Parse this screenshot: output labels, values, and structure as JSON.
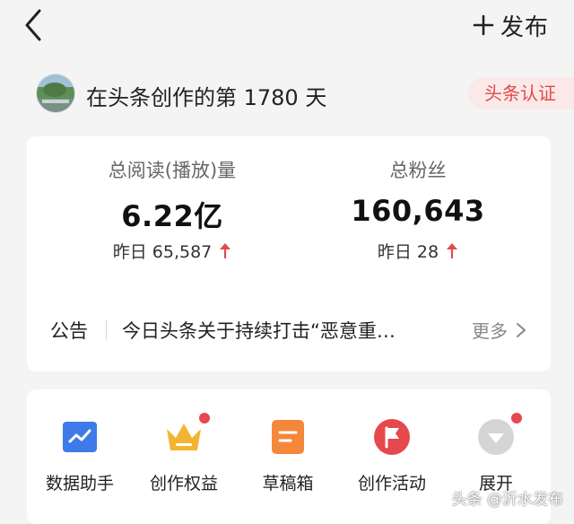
{
  "header": {
    "back_icon": "chevron-left-icon",
    "publish_label": "发布",
    "publish_icon": "plus-icon"
  },
  "creator": {
    "days_text": "在头条创作的第 1780 天",
    "cert_label": "头条认证"
  },
  "stats": {
    "reads_label": "总阅读(播放)量",
    "reads_value": "6.22亿",
    "reads_yesterday": "昨日 65,587",
    "fans_label": "总粉丝",
    "fans_value": "160,643",
    "fans_yesterday": "昨日 28",
    "up_color": "#e04a4a"
  },
  "notice": {
    "title": "公告",
    "text": "今日头条关于持续打击“恶意重…",
    "more_label": "更多"
  },
  "tools": [
    {
      "label": "数据助手",
      "icon": "data-chart-icon",
      "color": "#3f7be8",
      "badge": false
    },
    {
      "label": "创作权益",
      "icon": "crown-icon",
      "color": "#f3b531",
      "badge": true
    },
    {
      "label": "草稿箱",
      "icon": "draft-box-icon",
      "color": "#f5873b",
      "badge": false
    },
    {
      "label": "创作活动",
      "icon": "flag-icon",
      "color": "#e5484d",
      "badge": false
    },
    {
      "label": "展开",
      "icon": "expand-icon",
      "color": "#d5d5d5",
      "badge": true
    }
  ],
  "watermark": "头条 @沂水发布"
}
